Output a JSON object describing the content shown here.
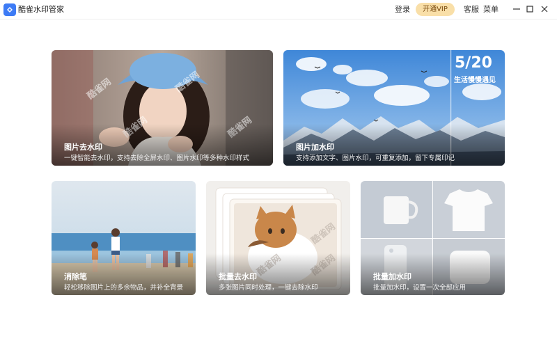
{
  "app": {
    "name": "酷雀水印管家"
  },
  "titlebar": {
    "login": "登录",
    "vip": "开通VIP",
    "service": "客服",
    "menu": "菜单"
  },
  "cards": [
    {
      "title": "图片去水印",
      "desc": "一键智能去水印，支持去除全屏水印、图片水印等多种水印样式",
      "watermark": "酷雀网"
    },
    {
      "title": "图片加水印",
      "desc": "支持添加文字、图片水印，可重复添加，留下专属印记",
      "date_text": "5/20",
      "sub_text": "生活慢慢遇见"
    },
    {
      "title": "消除笔",
      "desc": "轻松移除图片上的多余物品，并补全背景"
    },
    {
      "title": "批量去水印",
      "desc": "多张图片同时处理，一键去除水印",
      "watermark": "酷雀网"
    },
    {
      "title": "批量加水印",
      "desc": "批量加水印，设置一次全部应用"
    }
  ],
  "colors": {
    "accent": "#3d7bf5",
    "vip_bg": "#f9dfa8",
    "vip_text": "#7a4a0e"
  }
}
